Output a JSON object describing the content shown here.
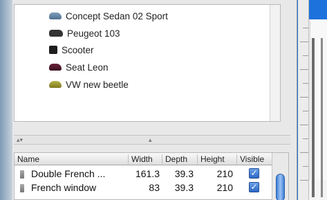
{
  "furniture_list": {
    "items": [
      {
        "label": "Concept Sedan 02 Sport",
        "icon": "car-sedan-icon"
      },
      {
        "label": "Peugeot 103",
        "icon": "moped-icon"
      },
      {
        "label": "Scooter",
        "icon": "scooter-icon"
      },
      {
        "label": "Seat Leon",
        "icon": "car-seat-icon"
      },
      {
        "label": "VW new beetle",
        "icon": "car-beetle-icon"
      }
    ]
  },
  "table": {
    "columns": [
      "Name",
      "Width",
      "Depth",
      "Height",
      "Visible"
    ],
    "rows": [
      {
        "name": "Double French ...",
        "width": "161.3",
        "depth": "39.3",
        "height": "210",
        "visible": true
      },
      {
        "name": "French window",
        "width": "83",
        "depth": "39.3",
        "height": "210",
        "visible": true
      }
    ]
  },
  "colors": {
    "selection_blue": "#1e72dc",
    "checkbox_blue": "#2d68c4"
  }
}
